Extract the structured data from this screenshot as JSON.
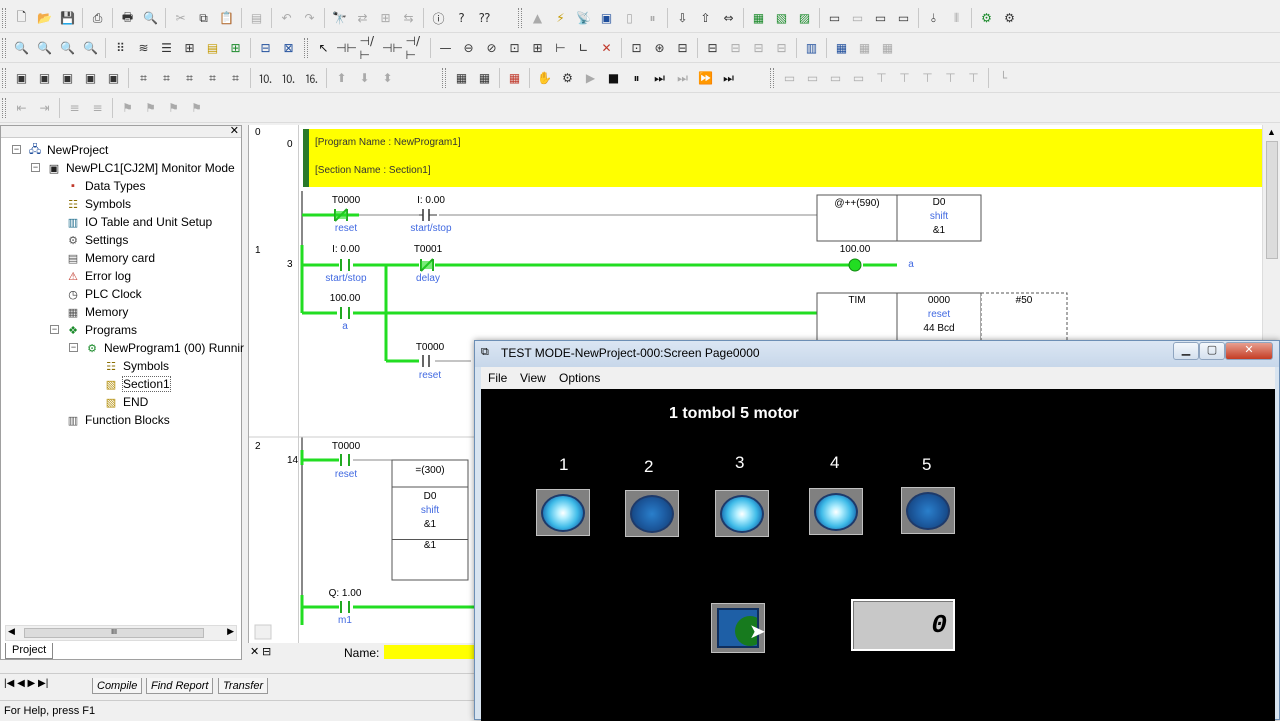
{
  "project_tree": {
    "items": [
      {
        "label": "NewProject",
        "icon": "project-icon"
      },
      {
        "label": "NewPLC1[CJ2M] Monitor Mode",
        "icon": "plc-icon"
      },
      {
        "label": "Data Types",
        "icon": "data-types-icon"
      },
      {
        "label": "Symbols",
        "icon": "symbols-icon"
      },
      {
        "label": "IO Table and Unit Setup",
        "icon": "io-table-icon"
      },
      {
        "label": "Settings",
        "icon": "settings-icon"
      },
      {
        "label": "Memory card",
        "icon": "memory-card-icon"
      },
      {
        "label": "Error log",
        "icon": "error-log-icon"
      },
      {
        "label": "PLC Clock",
        "icon": "clock-icon"
      },
      {
        "label": "Memory",
        "icon": "memory-icon"
      },
      {
        "label": "Programs",
        "icon": "programs-icon"
      },
      {
        "label": "NewProgram1 (00) Runnir",
        "icon": "program-icon"
      },
      {
        "label": "Symbols",
        "icon": "symbols-icon"
      },
      {
        "label": "Section1",
        "icon": "section-icon"
      },
      {
        "label": "END",
        "icon": "section-icon"
      },
      {
        "label": "Function Blocks",
        "icon": "function-blocks-icon"
      }
    ],
    "tab_label": "Project",
    "scroll_thumb": "III"
  },
  "ladder": {
    "rung_numbers": [
      "0",
      "1",
      "2"
    ],
    "step_numbers": [
      "0",
      "3",
      "14"
    ],
    "program_name": "[Program Name : NewProgram1]",
    "section_name": "[Section Name : Section1]",
    "rung0": {
      "c1_addr": "T0000",
      "c1_name": "reset",
      "c2_addr": "I: 0.00",
      "c2_name": "start/stop",
      "instr": "@++(590)",
      "op_addr": "D0",
      "op_name": "shift",
      "op_val": "&1"
    },
    "rung1": {
      "c1_addr": "I: 0.00",
      "c1_name": "start/stop",
      "c2_addr": "T0001",
      "c2_name": "delay",
      "coil_addr": "100.00",
      "coil_name": "a",
      "c3_addr": "100.00",
      "c3_name": "a",
      "c4_addr": "T0000",
      "c4_name": "reset",
      "tim": "TIM",
      "tim_addr": "0000",
      "tim_name": "reset",
      "tim_val": "44 Bcd",
      "tim_set": "#50"
    },
    "rung2": {
      "c1_addr": "T0000",
      "c1_name": "reset",
      "cmp": "=(300)",
      "cmp_addr": "D0",
      "cmp_name": "shift",
      "cmp_val": "&1",
      "cmp_val2": "&1",
      "c2_addr": "Q: 1.00",
      "c2_name": "m1"
    }
  },
  "name_bar": {
    "label": "Name:"
  },
  "output_tabs": [
    "Compile",
    "Find Report",
    "Transfer"
  ],
  "status_bar": {
    "text": "For Help, press F1"
  },
  "test_window": {
    "title": "TEST MODE-NewProject-000:Screen Page0000",
    "menu": [
      "File",
      "View",
      "Options"
    ],
    "screen_title": "1 tombol 5 motor",
    "motors": [
      {
        "label": "1",
        "state": "on"
      },
      {
        "label": "2",
        "state": "off"
      },
      {
        "label": "3",
        "state": "on"
      },
      {
        "label": "4",
        "state": "on"
      },
      {
        "label": "5",
        "state": "off"
      }
    ],
    "counter_value": "0"
  },
  "colors": {
    "header_band": "#ffff00",
    "active_rail": "#22dd22",
    "label_blue": "#4169e1",
    "screen_bg": "#000000"
  }
}
